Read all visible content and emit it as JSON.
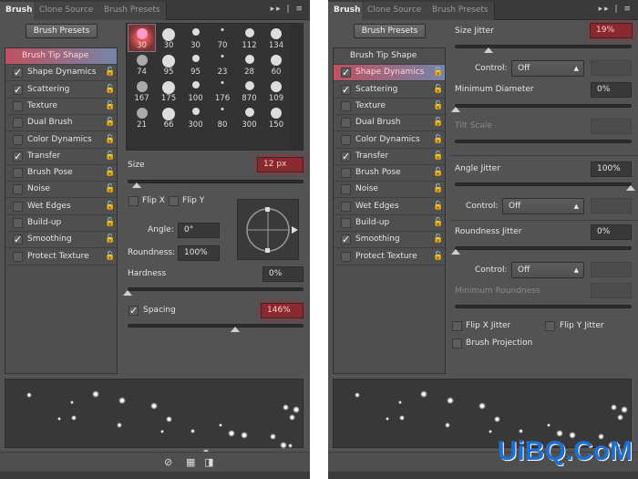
{
  "tabs": [
    "Brush",
    "Clone Source",
    "Brush Presets"
  ],
  "brush_presets_button": "Brush Presets",
  "options": [
    {
      "label": "Brush Tip Shape",
      "checked": null
    },
    {
      "label": "Shape Dynamics",
      "checked": true
    },
    {
      "label": "Scattering",
      "checked": true
    },
    {
      "label": "Texture",
      "checked": false
    },
    {
      "label": "Dual Brush",
      "checked": false
    },
    {
      "label": "Color Dynamics",
      "checked": false
    },
    {
      "label": "Transfer",
      "checked": true
    },
    {
      "label": "Brush Pose",
      "checked": false
    },
    {
      "label": "Noise",
      "checked": false
    },
    {
      "label": "Wet Edges",
      "checked": false
    },
    {
      "label": "Build-up",
      "checked": false
    },
    {
      "label": "Smoothing",
      "checked": true
    },
    {
      "label": "Protect Texture",
      "checked": false
    }
  ],
  "left_panel": {
    "selected_option": "Brush Tip Shape",
    "brush_tips": [
      "30",
      "30",
      "30",
      "70",
      "112",
      "134",
      "74",
      "95",
      "95",
      "23",
      "28",
      "60",
      "167",
      "175",
      "100",
      "176",
      "870",
      "109",
      "21",
      "66",
      "300",
      "80",
      "300",
      "150"
    ],
    "size_label": "Size",
    "size_value": "12 px",
    "flip_x": "Flip X",
    "flip_y": "Flip Y",
    "angle_label": "Angle:",
    "angle_value": "0°",
    "roundness_label": "Roundness:",
    "roundness_value": "100%",
    "hardness_label": "Hardness",
    "hardness_value": "0%",
    "spacing_label": "Spacing",
    "spacing_value": "146%",
    "spacing_checked": true
  },
  "right_panel": {
    "selected_option": "Shape Dynamics",
    "size_jitter_label": "Size Jitter",
    "size_jitter_value": "19%",
    "control_label": "Control:",
    "control_value": "Off",
    "min_diameter_label": "Minimum Diameter",
    "min_diameter_value": "0%",
    "tilt_scale_label": "Tilt Scale",
    "angle_jitter_label": "Angle Jitter",
    "angle_jitter_value": "100%",
    "roundness_jitter_label": "Roundness Jitter",
    "roundness_jitter_value": "0%",
    "min_roundness_label": "Minimum Roundness",
    "flip_x_jitter": "Flip X Jitter",
    "flip_y_jitter": "Flip Y Jitter",
    "brush_projection": "Brush Projection"
  },
  "icons": {
    "lock": "lock-icon",
    "check": "checkmark-icon",
    "menu": "panel-menu-icon"
  },
  "accent_color": "#8a2a2e",
  "watermark": "UiBQ.CoM"
}
